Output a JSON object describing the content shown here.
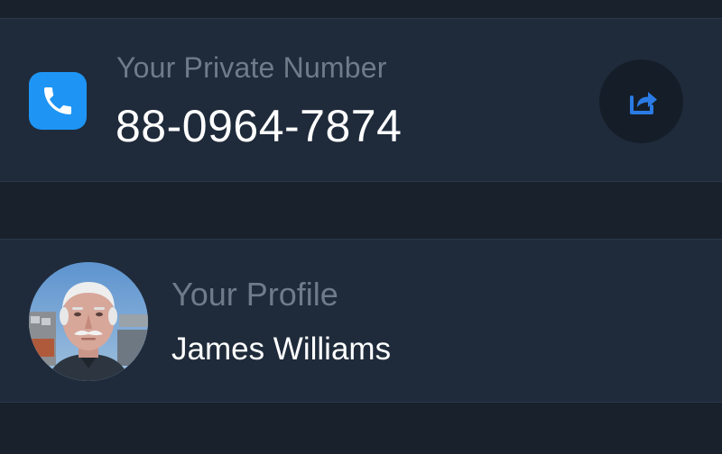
{
  "private_number": {
    "label": "Your Private Number",
    "value": "88-0964-7874",
    "icon": "phone-icon",
    "share_icon": "share-icon"
  },
  "profile": {
    "label": "Your Profile",
    "name": "James Williams",
    "avatar": "profile-photo"
  },
  "colors": {
    "background": "#18212c",
    "row_background": "#1f2b3b",
    "accent_blue": "#1e95f4",
    "share_icon": "#2b7be6",
    "muted_text": "#6f7b89"
  }
}
